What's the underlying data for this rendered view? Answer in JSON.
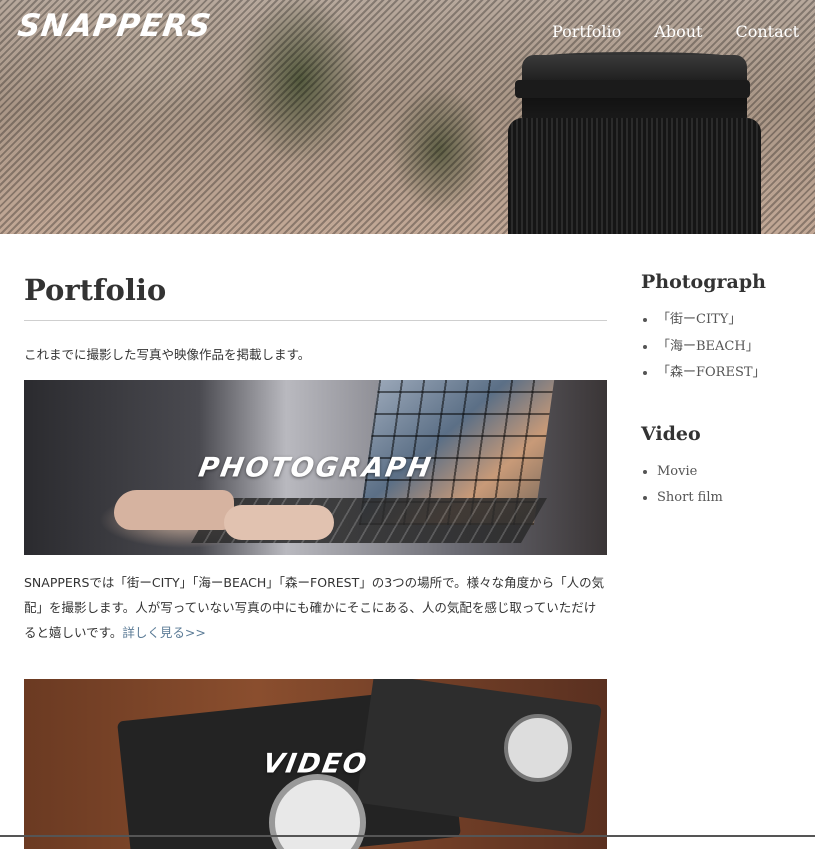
{
  "header": {
    "logo": "SNAPPERS",
    "nav": [
      "Portfolio",
      "About",
      "Contact"
    ]
  },
  "main": {
    "title": "Portfolio",
    "intro": "これまでに撮影した写真や映像作品を掲載します。",
    "sections": [
      {
        "label": "PHOTOGRAPH",
        "description": "SNAPPERSでは「街ーCITY」「海ーBEACH」「森ーFOREST」の3つの場所で。様々な角度から「人の気配」を撮影します。人が写っていない写真の中にも確かにそこにある、人の気配を感じ取っていただけると嬉しいです。",
        "link": "詳しく見る>>"
      },
      {
        "label": "VIDEO"
      }
    ]
  },
  "sidebar": {
    "groups": [
      {
        "heading": "Photograph",
        "items": [
          "「街ーCITY」",
          "「海ーBEACH」",
          "「森ーFOREST」"
        ]
      },
      {
        "heading": "Video",
        "items": [
          "Movie",
          "Short film"
        ]
      }
    ]
  },
  "colors": {
    "link": "#5b7b96",
    "text": "#333333"
  }
}
